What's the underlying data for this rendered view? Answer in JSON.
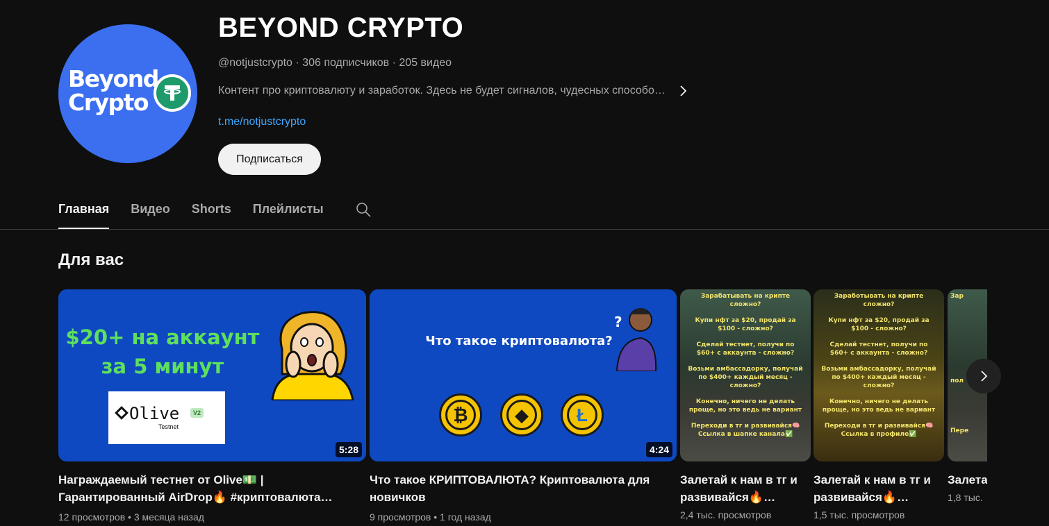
{
  "channel": {
    "avatar_text": "Beyond\nCrypto",
    "title": "BEYOND CRYPTO",
    "meta": "@notjustcrypto · 306 подписчиков · 205 видео",
    "description": "Контент про криптовалюту и заработок. Здесь не будет сигналов, чудесных способо…",
    "link": "t.me/notjustcrypto",
    "subscribe_label": "Подписаться"
  },
  "tabs": [
    {
      "label": "Главная",
      "active": true
    },
    {
      "label": "Видео",
      "active": false
    },
    {
      "label": "Shorts",
      "active": false
    },
    {
      "label": "Плейлисты",
      "active": false
    }
  ],
  "section": {
    "title": "Для вас"
  },
  "videos": [
    {
      "thumb_line1": "$20+ на аккаунт",
      "thumb_line2": "за 5 минут",
      "thumb_brand": "Olive",
      "thumb_brand_sub": "Testnet",
      "thumb_badge": "V2",
      "duration": "5:28",
      "title": "Награждаемый тестнет от Olive💵 | Гарантированный AirDrop🔥 #криптовалюта…",
      "meta": "12 просмотров • 3 месяца назад"
    },
    {
      "thumb_text": "Что такое криптовалюта?",
      "duration": "4:24",
      "title": "Что такое КРИПТОВАЛЮТА? Криптовалюта для новичков",
      "meta": "9 просмотров • 1 год назад"
    }
  ],
  "shorts": [
    {
      "lines": [
        "Зарабатывать на крипте сложно?",
        "Купи нфт за $20, продай за $100 - сложно?",
        "Сделай тестнет, получи по $60+ с аккаунта - сложно?",
        "Возьми амбассадорку, получай по $400+ каждый месяц - сложно?",
        "Конечно, ничего не делать проще, но это ведь не вариант",
        "Переходи в тг и развивайся🧠 Ссылка в шапке канала✅"
      ],
      "title": "Залетай к нам в тг и развивайся🔥…",
      "meta": "2,4 тыс. просмотров"
    },
    {
      "lines": [
        "Заработывать на крипте сложно?",
        "Купи нфт за $20, продай за $100 - сложно?",
        "Сделай тестнет, получи по $60+ с аккаунта - сложно?",
        "Возьми амбассадорку, получай по $400+ каждый месяц - сложно?",
        "Конечно, ничего не делать проще, но это ведь не вариант",
        "Переходи в тг и развивайся🧠 Ссылка в профиле✅"
      ],
      "title": "Залетай к нам в тг и развивайся🔥…",
      "meta": "1,5 тыс. просмотров"
    },
    {
      "lines": [
        "Зар",
        "пол",
        "Пере"
      ],
      "title": "Залета и разви",
      "meta": "1,8 тыс."
    }
  ]
}
